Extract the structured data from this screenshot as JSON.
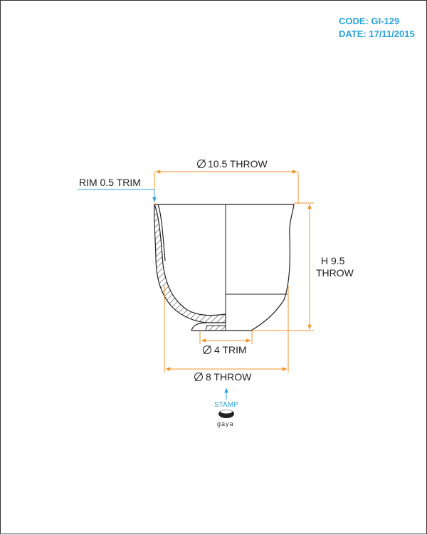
{
  "header": {
    "code": "CODE: GI-129",
    "date": "DATE: 17/11/2015"
  },
  "dimensions": {
    "top_diameter": "10.5 THROW",
    "rim": "RIM 0.5 TRIM",
    "height_line1": "H 9.5",
    "height_line2": "THROW",
    "foot_diameter": "4 TRIM",
    "base_diameter": "8 THROW",
    "diameter_symbol": "⌀"
  },
  "stamp": {
    "label": "STAMP",
    "logo_text": "gaya"
  },
  "colors": {
    "dimension": "#f0962e",
    "accent": "#29a3d8",
    "outline": "#222222"
  }
}
